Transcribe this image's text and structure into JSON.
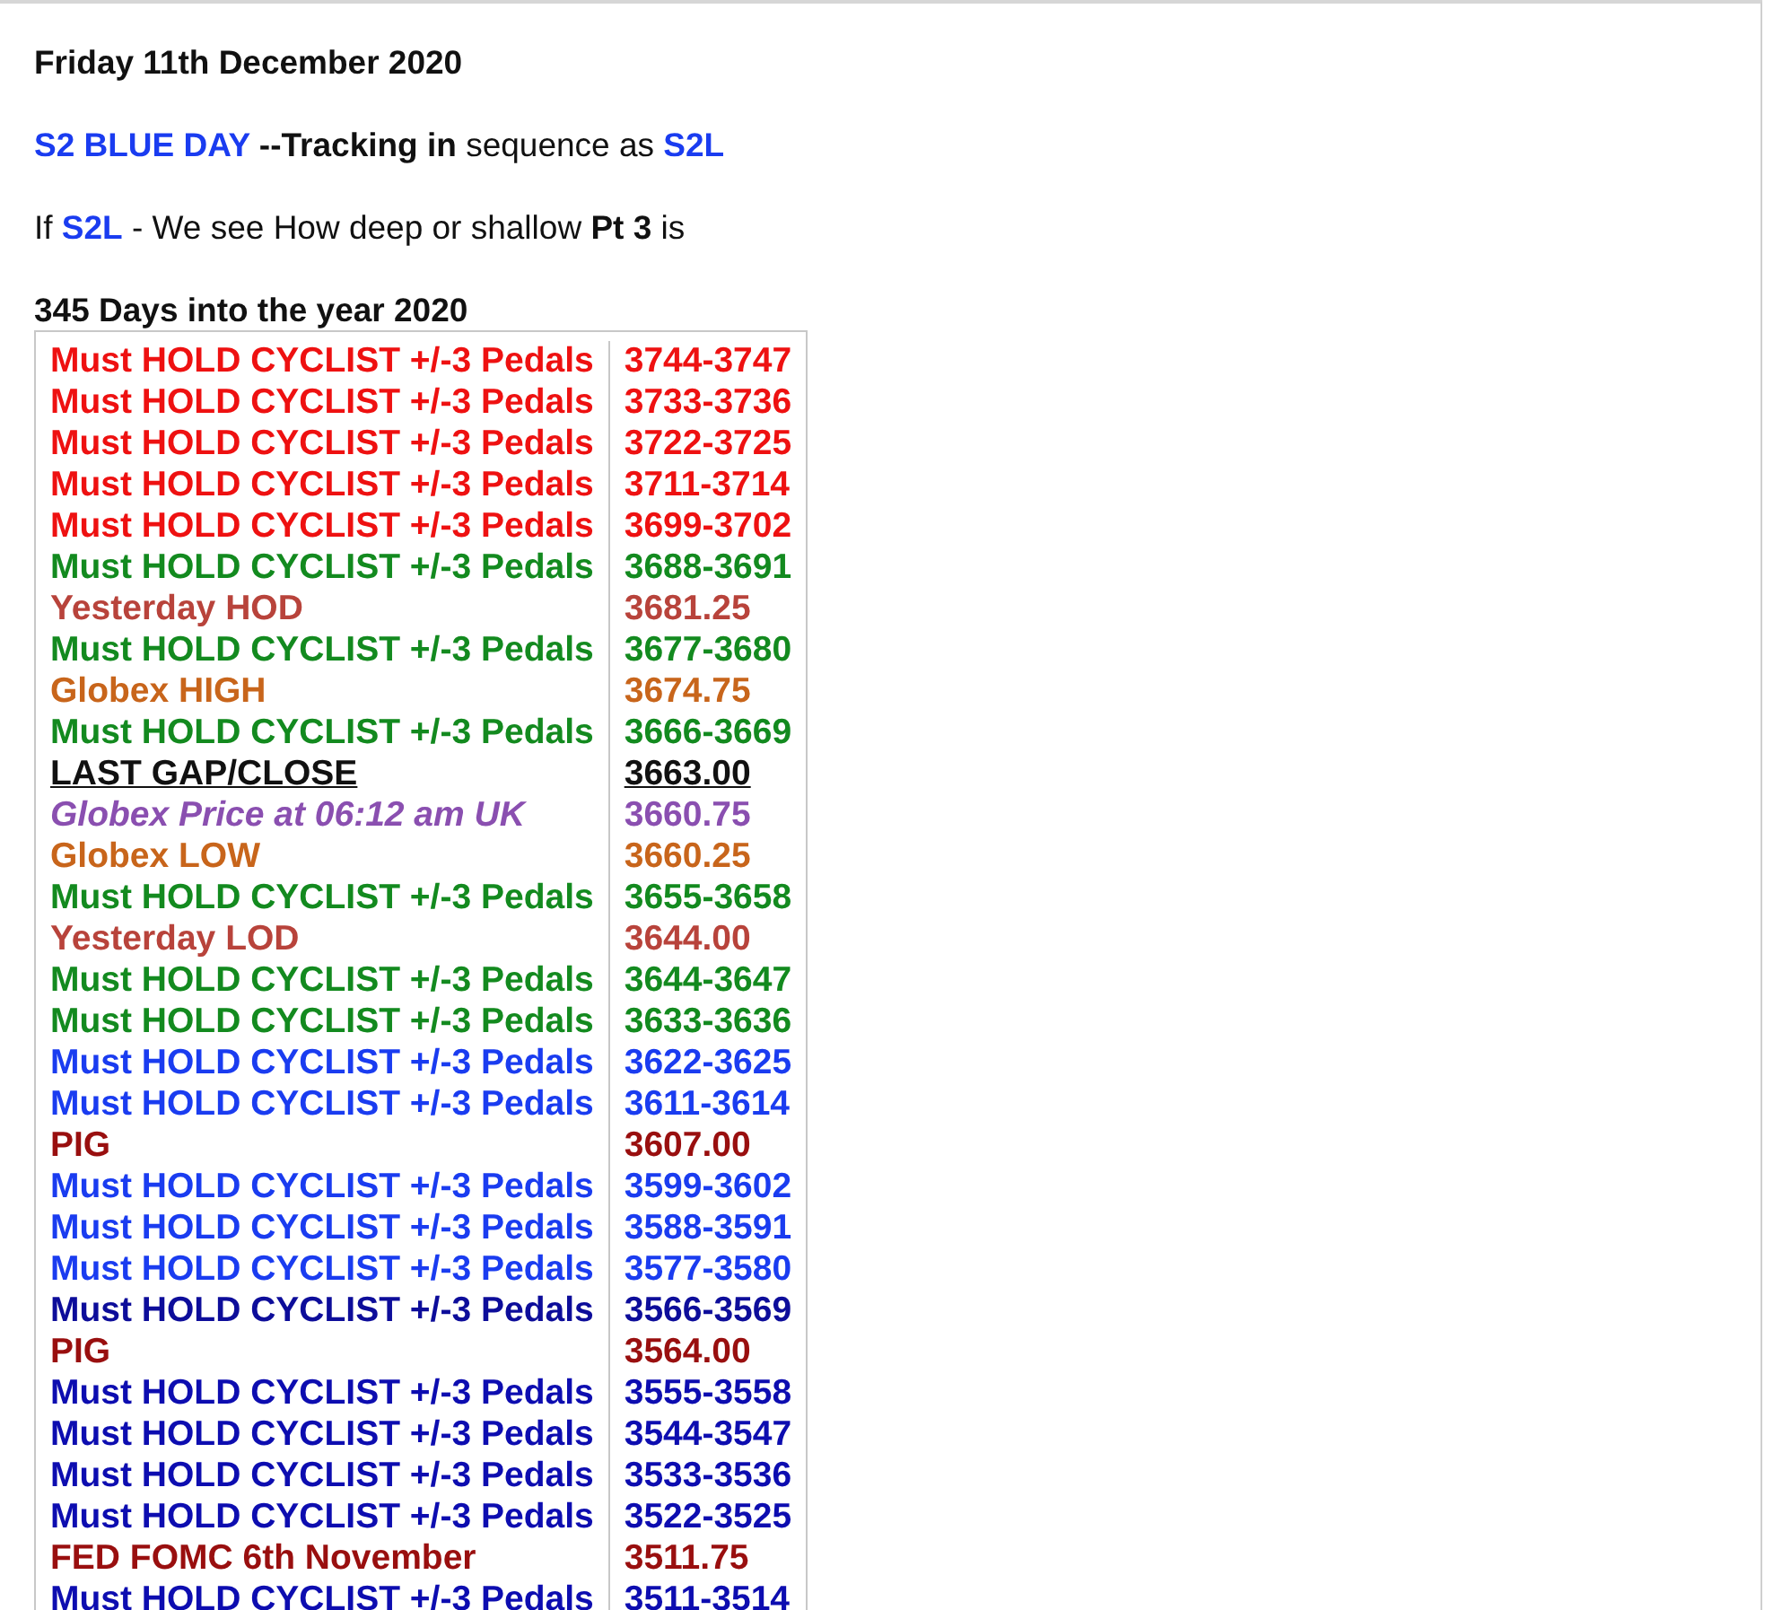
{
  "title": "Friday 11th December 2020",
  "paragraphs": [
    {
      "segments": [
        {
          "text": "S2 BLUE DAY",
          "bold": true,
          "color": "#1a3cf0"
        },
        {
          "text": " --Tracking in",
          "bold": true,
          "color": "#111111"
        },
        {
          "text": " sequence as ",
          "bold": false,
          "color": "#111111"
        },
        {
          "text": "S2L",
          "bold": true,
          "color": "#1a3cf0"
        }
      ]
    },
    {
      "segments": [
        {
          "text": "If ",
          "bold": false,
          "color": "#111111"
        },
        {
          "text": "S2L",
          "bold": true,
          "color": "#1a3cf0"
        },
        {
          "text": " - We see How deep or shallow ",
          "bold": false,
          "color": "#111111"
        },
        {
          "text": "Pt 3",
          "bold": true,
          "color": "#111111"
        },
        {
          "text": " is",
          "bold": false,
          "color": "#111111"
        }
      ]
    }
  ],
  "table_title": "345 Days into the year 2020",
  "rows": [
    {
      "label": "Must HOLD CYCLIST +/-3 Pedals",
      "value": "3744-3747",
      "color": "#ee1111",
      "kind": "plain"
    },
    {
      "label": "Must HOLD CYCLIST +/-3 Pedals",
      "value": "3733-3736",
      "color": "#ee1111",
      "kind": "plain"
    },
    {
      "label": "Must HOLD CYCLIST +/-3 Pedals",
      "value": "3722-3725",
      "color": "#ee1111",
      "kind": "plain"
    },
    {
      "label": "Must HOLD CYCLIST +/-3 Pedals",
      "value": "3711-3714",
      "color": "#ee1111",
      "kind": "plain"
    },
    {
      "label": "Must HOLD CYCLIST +/-3 Pedals",
      "value": "3699-3702",
      "color": "#ee1111",
      "kind": "plain"
    },
    {
      "label": "Must HOLD CYCLIST +/-3 Pedals",
      "value": "3688-3691",
      "color": "#138a1f",
      "kind": "plain"
    },
    {
      "label": "Yesterday HOD",
      "value": "3681.25",
      "color": "#b8433b",
      "kind": "plain"
    },
    {
      "label": "Must HOLD CYCLIST +/-3 Pedals",
      "value": "3677-3680",
      "color": "#138a1f",
      "kind": "plain"
    },
    {
      "label": "Globex HIGH",
      "value": "3674.75",
      "color": "#c8651b",
      "kind": "plain"
    },
    {
      "label": "Must HOLD CYCLIST +/-3 Pedals",
      "value": "3666-3669",
      "color": "#138a1f",
      "kind": "plain"
    },
    {
      "label": "LAST GAP/CLOSE",
      "value": "3663.00",
      "color": "#111111",
      "kind": "underline"
    },
    {
      "label": "Globex Price at 06:12 am UK",
      "value": "3660.75",
      "color": "#8a4fb0",
      "kind": "italic"
    },
    {
      "label": "Globex LOW",
      "value": "3660.25",
      "color": "#c8651b",
      "kind": "plain"
    },
    {
      "label": "Must HOLD CYCLIST +/-3 Pedals",
      "value": "3655-3658",
      "color": "#138a1f",
      "kind": "plain"
    },
    {
      "label": "Yesterday LOD",
      "value": "3644.00",
      "color": "#b8433b",
      "kind": "plain"
    },
    {
      "label": "Must HOLD CYCLIST +/-3 Pedals",
      "value": "3644-3647",
      "color": "#138a1f",
      "kind": "plain"
    },
    {
      "label": "Must HOLD CYCLIST +/-3 Pedals",
      "value": "3633-3636",
      "color": "#138a1f",
      "kind": "plain"
    },
    {
      "label": "Must HOLD CYCLIST +/-3 Pedals",
      "value": "3622-3625",
      "color": "#1a3cf0",
      "kind": "plain"
    },
    {
      "label": "Must HOLD CYCLIST +/-3 Pedals",
      "value": "3611-3614",
      "color": "#1a3cf0",
      "kind": "plain"
    },
    {
      "label": "PIG",
      "value": "3607.00",
      "color": "#990f0f",
      "kind": "plain"
    },
    {
      "label": "Must HOLD CYCLIST +/-3 Pedals",
      "value": "3599-3602",
      "color": "#1a3cf0",
      "kind": "plain"
    },
    {
      "label": "Must HOLD CYCLIST +/-3 Pedals",
      "value": "3588-3591",
      "color": "#1a3cf0",
      "kind": "plain"
    },
    {
      "label": "Must HOLD CYCLIST +/-3 Pedals",
      "value": "3577-3580",
      "color": "#1a3cf0",
      "kind": "plain"
    },
    {
      "label": "Must HOLD CYCLIST +/-3 Pedals",
      "value": "3566-3569",
      "color": "#0d0d9a",
      "kind": "plain"
    },
    {
      "label": "PIG",
      "value": "3564.00",
      "color": "#990f0f",
      "kind": "plain"
    },
    {
      "label": "Must HOLD CYCLIST +/-3 Pedals",
      "value": "3555-3558",
      "color": "#0d0db0",
      "kind": "plain"
    },
    {
      "label": "Must HOLD CYCLIST +/-3 Pedals",
      "value": "3544-3547",
      "color": "#0d0db0",
      "kind": "plain"
    },
    {
      "label": "Must HOLD CYCLIST +/-3 Pedals",
      "value": "3533-3536",
      "color": "#0d0db0",
      "kind": "plain"
    },
    {
      "label": "Must HOLD CYCLIST +/-3 Pedals",
      "value": "3522-3525",
      "color": "#0d0db0",
      "kind": "plain"
    },
    {
      "label": "FED FOMC 6th November",
      "value": "3511.75",
      "color": "#990f0f",
      "kind": "plain"
    },
    {
      "label": "Must HOLD CYCLIST +/-3 Pedals",
      "value": "3511-3514",
      "color": "#0d0db0",
      "kind": "plain"
    }
  ]
}
